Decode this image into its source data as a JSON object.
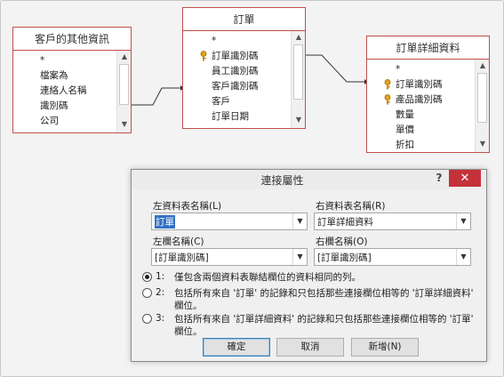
{
  "tables": {
    "customer_info": {
      "title": "客戶的其他資訊",
      "fields": [
        "*",
        "檔案為",
        "連絡人名稱",
        "識別碼",
        "公司"
      ]
    },
    "orders": {
      "title": "訂單",
      "fields": [
        "*",
        "訂單識別碼",
        "員工識別碼",
        "客戶識別碼",
        "客戶",
        "訂單日期"
      ]
    },
    "order_details": {
      "title": "訂單詳細資料",
      "fields": [
        "*",
        "訂單識別碼",
        "產品識別碼",
        "數量",
        "單價",
        "折扣"
      ]
    }
  },
  "dialog": {
    "title": "連接屬性",
    "help": "?",
    "close": "✕",
    "left_table_label": "左資料表名稱(L)",
    "left_table_value": "訂單",
    "right_table_label": "右資料表名稱(R)",
    "right_table_value": "訂單詳細資料",
    "left_col_label": "左欄名稱(C)",
    "left_col_value": "[訂單識別碼]",
    "right_col_label": "右欄名稱(O)",
    "right_col_value": "[訂單識別碼]",
    "options": [
      {
        "num": "1:",
        "text": "僅包含兩個資料表聯結欄位的資料相同的列。",
        "selected": true
      },
      {
        "num": "2:",
        "text": "包括所有來自 '訂單' 的記錄和只包括那些連接欄位相等的 '訂單詳細資料' 欄位。",
        "selected": false
      },
      {
        "num": "3:",
        "text": "包括所有來自 '訂單詳細資料' 的記錄和只包括那些連接欄位相等的 '訂單' 欄位。",
        "selected": false
      }
    ],
    "ok": "確定",
    "cancel": "取消",
    "new": "新增(N)"
  }
}
